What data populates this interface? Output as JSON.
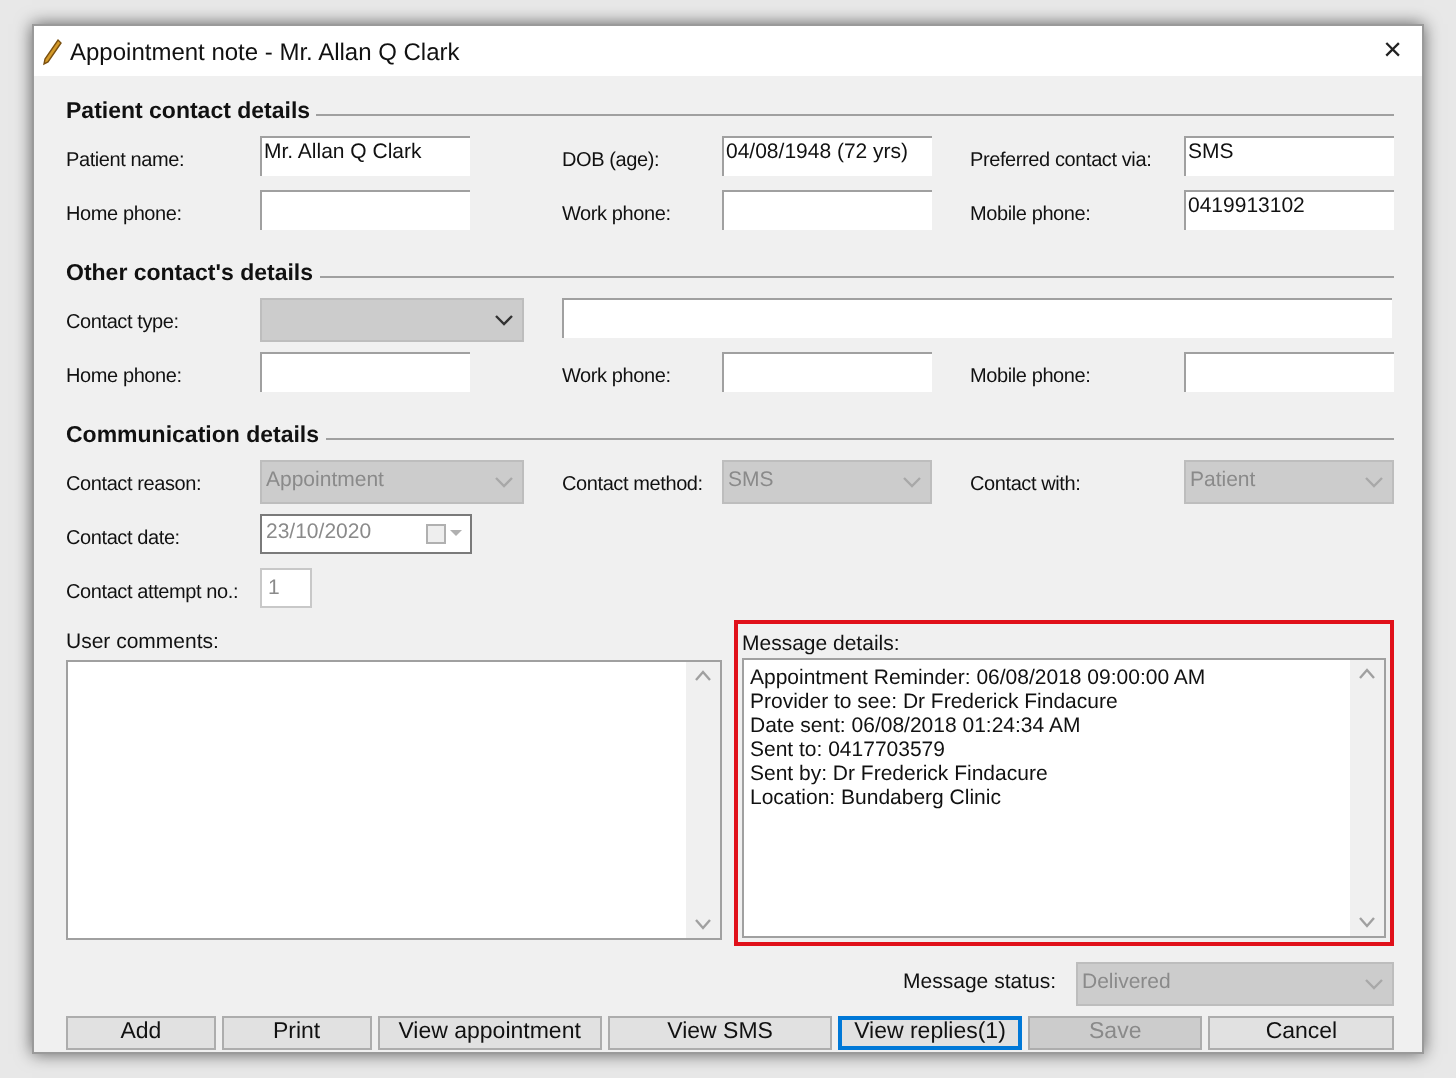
{
  "window": {
    "title": "Appointment note - Mr. Allan Q Clark",
    "close": "×"
  },
  "sections": [
    {
      "title": "Patient contact details",
      "rows": [
        [
          {
            "kind": "text",
            "label": "Patient name:",
            "value": "Mr. Allan Q Clark"
          },
          {
            "kind": "text",
            "label": "DOB (age):",
            "value": "04/08/1948 (72 yrs)"
          },
          {
            "kind": "text",
            "label": "Preferred contact via:",
            "value": "SMS"
          }
        ],
        [
          {
            "kind": "text",
            "label": "Home phone:"
          },
          {
            "kind": "text",
            "label": "Work phone:"
          },
          {
            "kind": "text",
            "label": "Mobile phone:",
            "value": "0419913102"
          }
        ]
      ]
    },
    {
      "title": "Other contact's details",
      "rows": [
        [
          {
            "kind": "dropdown",
            "label": "Contact type:",
            "disabled": false
          },
          {
            "kind": "wide_text"
          }
        ],
        [
          {
            "kind": "text",
            "label": "Home phone:"
          },
          {
            "kind": "text",
            "label": "Work phone:"
          },
          {
            "kind": "text",
            "label": "Mobile phone:"
          }
        ]
      ]
    },
    {
      "title": "Communication details",
      "rows": [
        [
          {
            "kind": "dropdown",
            "label": "Contact reason:",
            "value": "Appointment",
            "disabled": true
          },
          {
            "kind": "dropdown",
            "label": "Contact method:",
            "value": "SMS",
            "disabled": true
          },
          {
            "kind": "dropdown",
            "label": "Contact with:",
            "value": "Patient",
            "disabled": true
          }
        ],
        [
          {
            "kind": "date",
            "label": "Contact date:",
            "value": "23/10/2020",
            "disabled": true
          }
        ],
        [
          {
            "kind": "number",
            "label": "Contact attempt no.:",
            "value": "1",
            "disabled": true
          }
        ]
      ]
    }
  ],
  "user_comments": {
    "label": "User comments:"
  },
  "message_details": {
    "label": "Message details:",
    "highlighted": true,
    "lines": [
      "Appointment Reminder: 06/08/2018 09:00:00 AM",
      "Provider to see: Dr Frederick Findacure",
      "Date sent: 06/08/2018 01:24:34 AM",
      "Sent to: 0417703579",
      "Sent by: Dr Frederick Findacure",
      "Location: Bundaberg Clinic"
    ]
  },
  "message_status": {
    "label": "Message status:",
    "value": "Delivered",
    "disabled": true
  },
  "buttons": [
    {
      "label": "Add",
      "focused": false,
      "disabled": false
    },
    {
      "label": "Print",
      "focused": false,
      "disabled": false
    },
    {
      "label": "View appointment",
      "focused": false,
      "disabled": false
    },
    {
      "label": "View SMS",
      "focused": false,
      "disabled": false
    },
    {
      "label": "View replies(1)",
      "focused": true,
      "disabled": false
    },
    {
      "label": "Save",
      "focused": false,
      "disabled": true
    },
    {
      "label": "Cancel",
      "focused": false,
      "disabled": false
    }
  ]
}
